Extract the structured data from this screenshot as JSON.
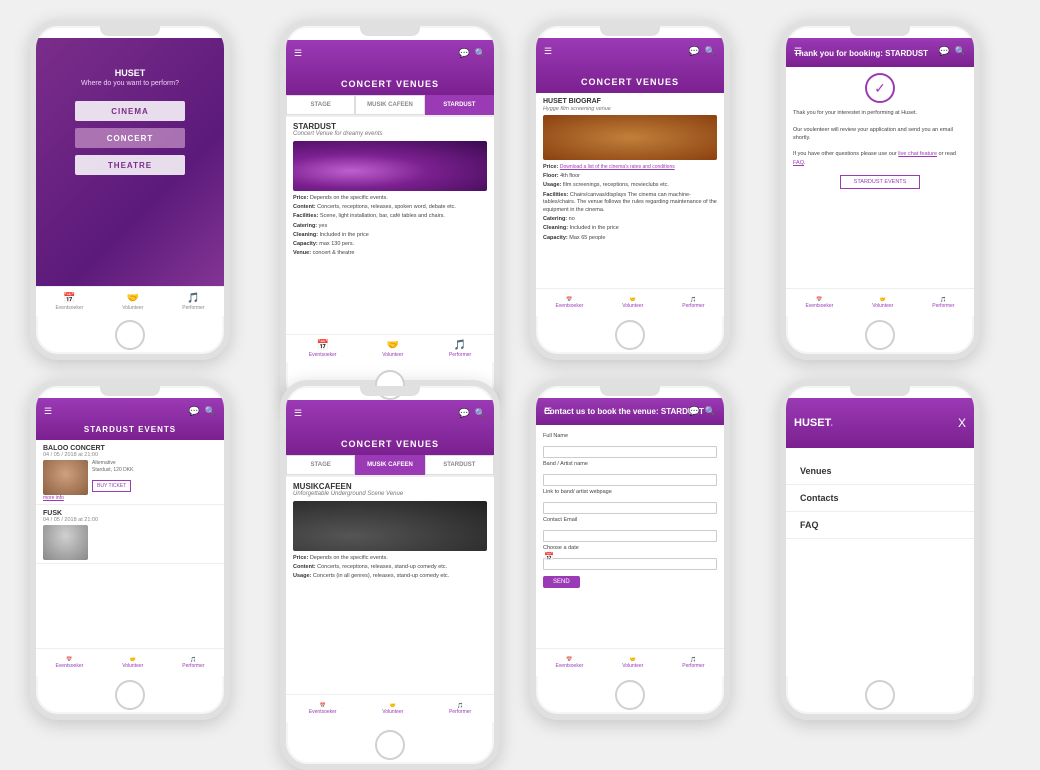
{
  "screens": [
    {
      "id": "landing",
      "title": "HUSET",
      "subtitle": "Where do you want to perform?",
      "buttons": [
        "CINEMA",
        "CONCERT",
        "THEATRE"
      ],
      "nav": [
        "Eventsoeker",
        "Volunteer",
        "Performer"
      ]
    },
    {
      "id": "concert-venues-stardust",
      "header": "CONCERT VENUES",
      "tabs": [
        "STAGE",
        "MUSIK CAFEEN",
        "STARDUST"
      ],
      "active_tab": "STARDUST",
      "venue_name": "STARDUST",
      "venue_tagline": "Concert Venue for dreamy events",
      "details": [
        {
          "label": "Price:",
          "value": "Depends on the specific events."
        },
        {
          "label": "Content:",
          "value": "Concerts, receptions, releases, spoken word, debate etc."
        },
        {
          "label": "Facilities:",
          "value": "Scene, light installation, bar, café tables and chairs."
        },
        {
          "label": "Catering:",
          "value": "yes"
        },
        {
          "label": "Cleaning:",
          "value": "Included in the price"
        },
        {
          "label": "Capacity:",
          "value": "max 130 pers."
        },
        {
          "label": "Venue:",
          "value": "concert & theatre"
        }
      ],
      "nav": [
        "Eventsoeker",
        "Volunteer",
        "Performer"
      ]
    },
    {
      "id": "huset-biograf",
      "header": "CONCERT VENUES",
      "venue_name": "HUSET BIOGRAF",
      "venue_tagline": "Hygge film screening venue",
      "details": [
        {
          "label": "Price:",
          "value": "Download a list of the cinema's rates and conditions"
        },
        {
          "label": "Floor:",
          "value": "4th floor"
        },
        {
          "label": "Usage:",
          "value": "Film screenings, receptions, movieclubs etc."
        },
        {
          "label": "Facilities:",
          "value": "Chairs/canvas/displays The cinema can machine-tables/chairs. The venue follows the rules regarding maintenance of the equipment in the cinema."
        },
        {
          "label": "Catering:",
          "value": "no"
        },
        {
          "label": "Cleaning:",
          "value": "Included in the price"
        },
        {
          "label": "Capacity:",
          "value": "Max 65 people"
        }
      ],
      "nav": [
        "Eventsoeker",
        "Volunteer",
        "Performer"
      ]
    },
    {
      "id": "thank-you",
      "header": "Thank you for booking: STARDUST",
      "body_text": "Thak you for your interest in performing at Huset.\n\nOur voulenteer will review your application and send you an email shortly.\n\nIf you have other questions please use our live chat feature or read FAQ.",
      "cta_button": "STARDUST EVENTS",
      "nav": [
        "Eventsoeker",
        "Volunteer",
        "Performer"
      ]
    },
    {
      "id": "stardust-events",
      "header": "STARDUST EVENTS",
      "events": [
        {
          "title": "BALOO CONCERT",
          "date": "04 / 05 / 2018 at 21:00",
          "meta": "Alternative",
          "venue": "Stardust, 120 DKK",
          "more_info": "more info"
        },
        {
          "title": "FUSK",
          "date": "04 / 05 / 2018 at 21:00"
        }
      ],
      "nav": [
        "Eventsoeker",
        "Volunteer",
        "Performer"
      ]
    },
    {
      "id": "concert-venues-musikcafeen",
      "header": "CONCERT VENUES",
      "tabs": [
        "STAGE",
        "MUSIK CAFEEN",
        "STARDUST"
      ],
      "active_tab": "MUSIK CAFEEN",
      "venue_name": "MUSIKCAFEEN",
      "venue_tagline": "Unforgettable Underground Scene Venue",
      "details": [
        {
          "label": "Price:",
          "value": "Depends on the specific events."
        },
        {
          "label": "Content:",
          "value": "Concerts, receptions, releases, stand-up comedy etc."
        },
        {
          "label": "Usage:",
          "value": "Concerts (in all genres), releases, stand-up comedy etc."
        }
      ],
      "nav": [
        "Eventsoeker",
        "Volunteer",
        "Performer"
      ]
    },
    {
      "id": "contact-form",
      "header": "Contact us to book the venue: STARDUST",
      "fields": [
        {
          "label": "Full Name",
          "type": "text"
        },
        {
          "label": "Band / Artist name",
          "type": "text"
        },
        {
          "label": "Link to band/ artist webpage",
          "type": "text"
        },
        {
          "label": "Contact Email",
          "type": "text"
        },
        {
          "label": "Choose a date",
          "type": "date"
        }
      ],
      "send_button": "SEND",
      "nav": [
        "Eventsoeker",
        "Volunteer",
        "Performer"
      ]
    },
    {
      "id": "menu-overlay",
      "logo": "HUSET.",
      "close": "X",
      "menu_items": [
        "Venues",
        "Contacts",
        "FAQ"
      ]
    }
  ]
}
